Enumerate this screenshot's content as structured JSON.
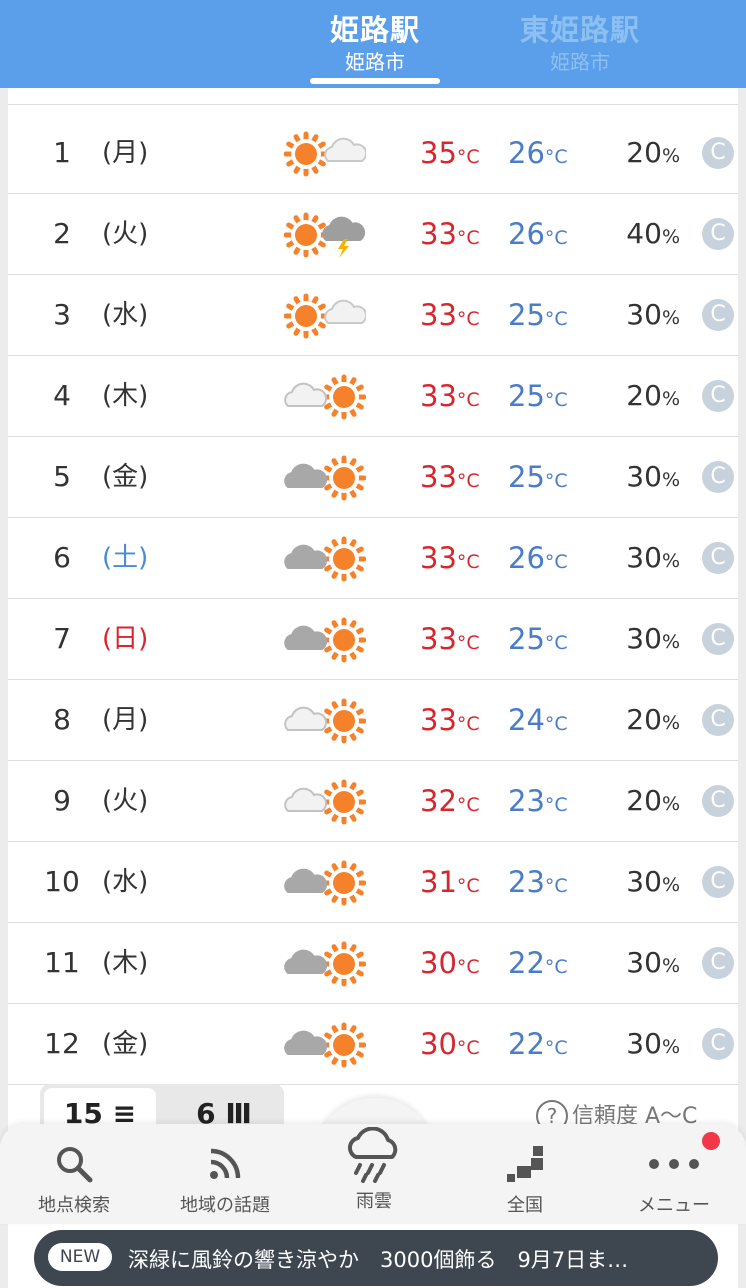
{
  "header": {
    "tabs": [
      {
        "name": "姫路駅",
        "city": "姫路市"
      },
      {
        "name": "東姫路駅",
        "city": "姫路市"
      }
    ]
  },
  "forecast": {
    "temp_unit": "°C",
    "rain_unit": "%",
    "rows": [
      {
        "day": "1",
        "dow": "(月)",
        "weather": "sunny-then-cloudy",
        "high": "35",
        "low": "26",
        "rain": "20",
        "reliability": "C"
      },
      {
        "day": "2",
        "dow": "(火)",
        "weather": "sunny-then-thunder",
        "high": "33",
        "low": "26",
        "rain": "40",
        "reliability": "C"
      },
      {
        "day": "3",
        "dow": "(水)",
        "weather": "sunny-then-cloudy",
        "high": "33",
        "low": "25",
        "rain": "30",
        "reliability": "C"
      },
      {
        "day": "4",
        "dow": "(木)",
        "weather": "cloudy-sun-light",
        "high": "33",
        "low": "25",
        "rain": "20",
        "reliability": "C"
      },
      {
        "day": "5",
        "dow": "(金)",
        "weather": "cloudy-sun",
        "high": "33",
        "low": "25",
        "rain": "30",
        "reliability": "C"
      },
      {
        "day": "6",
        "dow": "(土)",
        "weather": "cloudy-sun",
        "high": "33",
        "low": "26",
        "rain": "30",
        "reliability": "C"
      },
      {
        "day": "7",
        "dow": "(日)",
        "weather": "cloudy-sun",
        "high": "33",
        "low": "25",
        "rain": "30",
        "reliability": "C"
      },
      {
        "day": "8",
        "dow": "(月)",
        "weather": "cloudy-sun-light",
        "high": "33",
        "low": "24",
        "rain": "20",
        "reliability": "C"
      },
      {
        "day": "9",
        "dow": "(火)",
        "weather": "cloudy-sun-light",
        "high": "32",
        "low": "23",
        "rain": "20",
        "reliability": "C"
      },
      {
        "day": "10",
        "dow": "(水)",
        "weather": "cloudy-sun",
        "high": "31",
        "low": "23",
        "rain": "30",
        "reliability": "C"
      },
      {
        "day": "11",
        "dow": "(木)",
        "weather": "cloudy-sun",
        "high": "30",
        "low": "22",
        "rain": "30",
        "reliability": "C"
      },
      {
        "day": "12",
        "dow": "(金)",
        "weather": "cloudy-sun",
        "high": "30",
        "low": "22",
        "rain": "30",
        "reliability": "C"
      }
    ]
  },
  "controls": {
    "toggle_15": "15",
    "toggle_6": "6",
    "reliability_label": "信頼度 A～C",
    "help_glyph": "?"
  },
  "nav": {
    "items": [
      {
        "label": "地点検索",
        "icon": "search-icon"
      },
      {
        "label": "地域の話題",
        "icon": "rss-icon"
      },
      {
        "label": "雨雲",
        "icon": "rain-cloud-icon"
      },
      {
        "label": "全国",
        "icon": "map-icon"
      },
      {
        "label": "メニュー",
        "icon": "more-icon"
      }
    ]
  },
  "news": {
    "badge": "NEW",
    "text": "深緑に風鈴の響き涼やか　3000個飾る　9月7日ま…"
  },
  "colors": {
    "header": "#5b9ee9",
    "high_temp": "#d8262e",
    "low_temp": "#4a7cc8",
    "saturday": "#4a8ad8",
    "sunday": "#d8262e",
    "sun": "#f5822a"
  }
}
